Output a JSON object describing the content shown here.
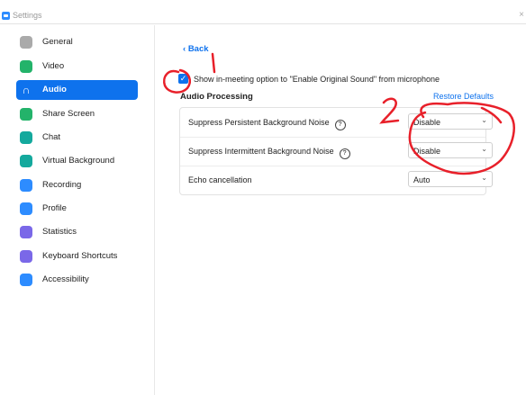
{
  "window": {
    "title": "Settings"
  },
  "sidebar": {
    "items": [
      {
        "label": "General",
        "icon": "gear-icon"
      },
      {
        "label": "Video",
        "icon": "video-camera-icon"
      },
      {
        "label": "Audio",
        "icon": "headphones-icon",
        "active": true
      },
      {
        "label": "Share Screen",
        "icon": "share-screen-icon"
      },
      {
        "label": "Chat",
        "icon": "chat-bubble-icon"
      },
      {
        "label": "Virtual Background",
        "icon": "virtual-background-icon"
      },
      {
        "label": "Recording",
        "icon": "record-icon"
      },
      {
        "label": "Profile",
        "icon": "profile-icon"
      },
      {
        "label": "Statistics",
        "icon": "bar-chart-icon"
      },
      {
        "label": "Keyboard Shortcuts",
        "icon": "keyboard-icon"
      },
      {
        "label": "Accessibility",
        "icon": "accessibility-icon"
      }
    ]
  },
  "main": {
    "back_label": "Back",
    "original_sound_checkbox": {
      "label": "Show in-meeting option to \"Enable Original Sound\" from microphone",
      "checked": true
    },
    "audio_processing": {
      "title": "Audio Processing",
      "restore_label": "Restore Defaults",
      "rows": [
        {
          "label": "Suppress Persistent Background Noise",
          "help": true,
          "value": "Disable"
        },
        {
          "label": "Suppress Intermittent Background Noise",
          "help": true,
          "value": "Disable"
        },
        {
          "label": "Echo cancellation",
          "help": false,
          "value": "Auto"
        }
      ]
    }
  },
  "annotations": {
    "mark_1": "1",
    "mark_2": "2",
    "color": "#e8202a"
  },
  "colors": {
    "accent": "#0e72ed",
    "brand": "#2d8cff"
  }
}
